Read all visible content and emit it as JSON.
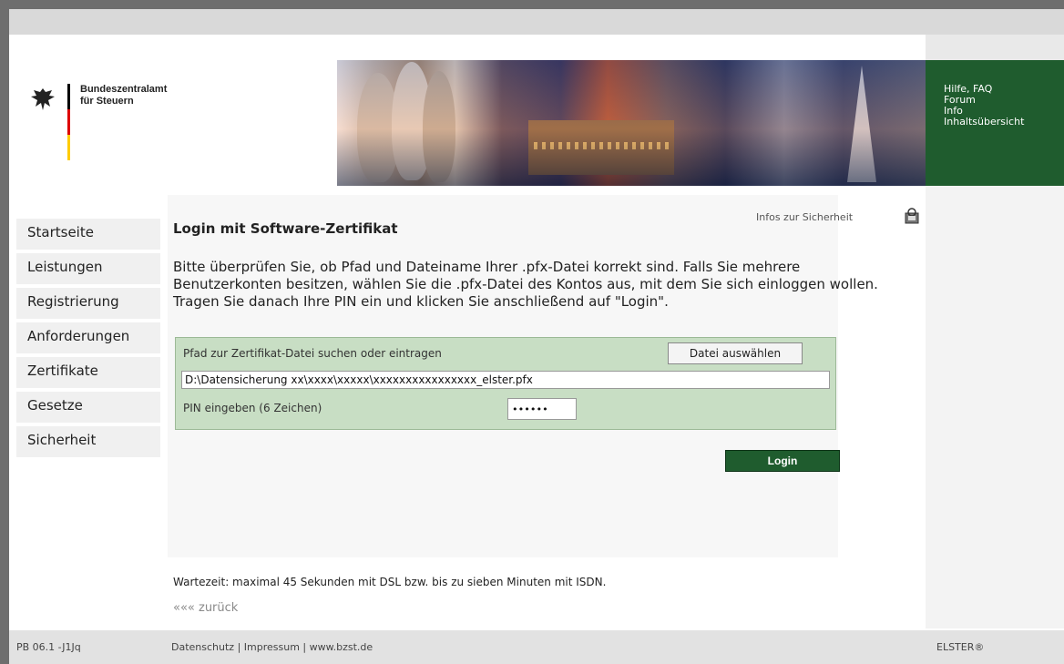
{
  "header": {
    "org_line1": "Bundeszentralamt",
    "org_line2": "für Steuern",
    "help_links": [
      "Hilfe, FAQ",
      "Forum",
      "Info",
      "Inhaltsübersicht"
    ]
  },
  "nav": {
    "items": [
      "Startseite",
      "Leistungen",
      "Registrierung",
      "Anforderungen",
      "Zertifikate",
      "Gesetze",
      "Sicherheit"
    ]
  },
  "main": {
    "title": "Login mit Software-Zertifikat",
    "security_info": "Infos zur Sicherheit",
    "instructions": "Bitte überprüfen Sie, ob Pfad und Dateiname Ihrer .pfx-Datei korrekt sind. Falls Sie mehrere Benutzerkonten besitzen, wählen Sie die .pfx-Datei des Kontos aus, mit dem Sie sich einloggen wollen. Tragen Sie danach Ihre PIN ein und klicken Sie anschließend auf \"Login\".",
    "cert_label": "Pfad zur Zertifikat-Datei suchen oder eintragen",
    "choose_file_label": "Datei auswählen",
    "path_value": "D:\\Datensicherung xx\\xxxx\\xxxxx\\xxxxxxxxxxxxxxxx_elster.pfx",
    "pin_label": "PIN eingeben (6 Zeichen)",
    "pin_value": "••••••",
    "login_label": "Login",
    "wait_note": "Wartezeit: maximal 45 Sekunden mit DSL bzw. bis zu sieben Minuten mit ISDN.",
    "back_link": "««« zurück"
  },
  "footer": {
    "version": "PB 06.1 -J1Jq",
    "links": [
      "Datenschutz",
      "Impressum",
      "www.bzst.de"
    ],
    "separator": " | ",
    "brand": "ELSTER®"
  },
  "colors": {
    "accent_green": "#1f5c2e",
    "form_green": "#c8dec4"
  }
}
